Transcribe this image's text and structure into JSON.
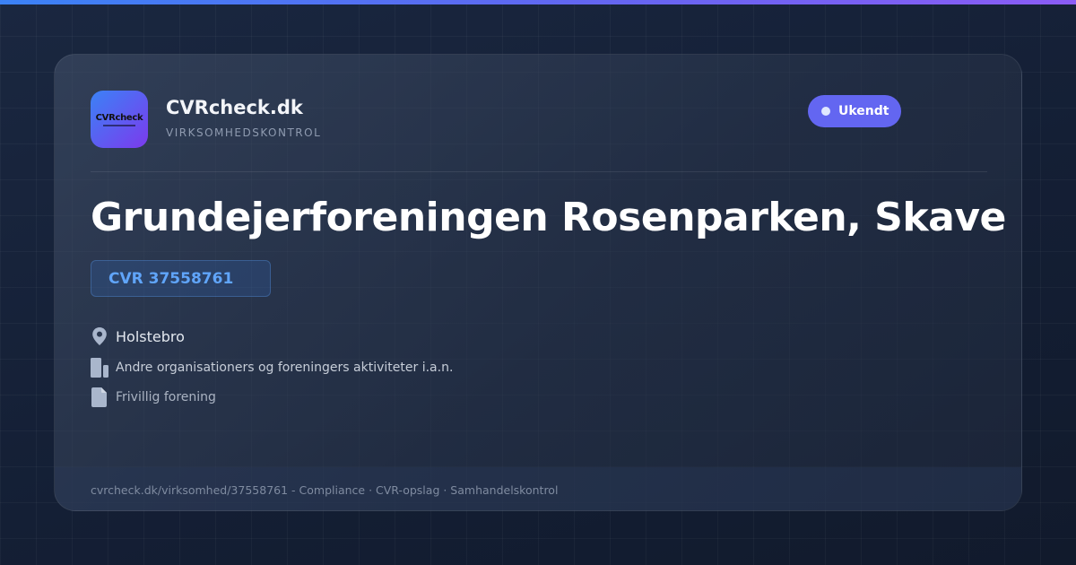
{
  "brand": {
    "logo_text": "CVRcheck",
    "name": "CVRcheck.dk",
    "tagline": "VIRKSOMHEDSKONTROL"
  },
  "status": {
    "label": "Ukendt"
  },
  "company": {
    "name": "Grundejerforeningen Rosenparken, Skave",
    "cvr": "CVR 37558761",
    "city": "Holstebro",
    "industry": "Andre organisationers og foreningers aktiviteter i.a.n.",
    "company_type": "Frivillig forening"
  },
  "footer": {
    "text": "cvrcheck.dk/virksomhed/37558761 - Compliance · CVR-opslag · Samhandelskontrol"
  },
  "icons": [
    "location-pin-icon",
    "building-icon",
    "document-icon"
  ],
  "colors": {
    "accent": "#6366f1",
    "cvr_blue": "#60a5fa",
    "background": "#0f1a2e"
  }
}
